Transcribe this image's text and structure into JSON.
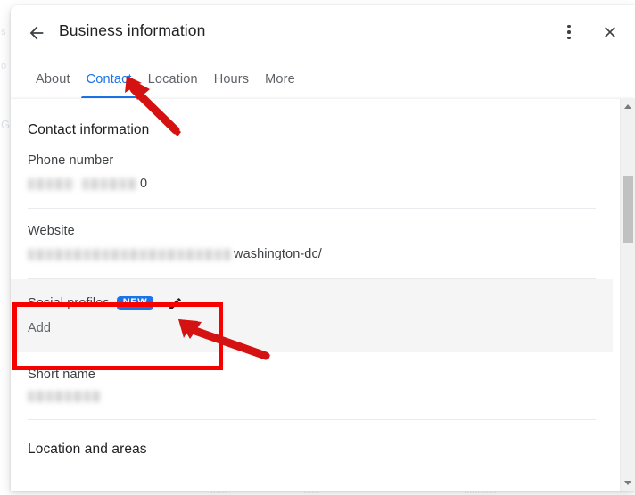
{
  "window": {
    "title": "Business information",
    "back_icon": "arrow-left-icon",
    "menu_icon": "kebab-menu-icon",
    "close_icon": "close-icon"
  },
  "tabs": [
    {
      "label": "About",
      "active": false
    },
    {
      "label": "Contact",
      "active": true
    },
    {
      "label": "Location",
      "active": false
    },
    {
      "label": "Hours",
      "active": false
    },
    {
      "label": "More",
      "active": false
    }
  ],
  "content": {
    "section_title": "Contact information",
    "rows": [
      {
        "label": "Phone number",
        "value_redacted": true,
        "value_suffix": "0",
        "highlight": false
      },
      {
        "label": "Website",
        "value_redacted": true,
        "value_suffix": "washington-dc/",
        "highlight": false
      },
      {
        "label": "Social profiles",
        "badge": "NEW",
        "edit_icon": "pencil-icon",
        "value_text": "Add",
        "highlight": true
      },
      {
        "label": "Short name",
        "value_redacted": true,
        "value_suffix": "",
        "highlight": false
      }
    ],
    "bottom_section_title": "Location and areas"
  },
  "scrollbar": {
    "up_arrow": "scroll-up-arrow-icon",
    "down_arrow": "scroll-down-arrow-icon"
  },
  "annotations": {
    "accent_color": "#f70000",
    "highlight_box_target": "Social profiles",
    "arrow_1_target": "Contact tab",
    "arrow_2_target": "Social profiles edit pencil"
  },
  "backdrop": {
    "ghost_left_1": "s",
    "ghost_left_2": "o",
    "ghost_left_3": "G",
    "ghost_bottom_1": "......",
    "ghost_bottom_2": "......",
    "ghost_bottom_3": "............"
  },
  "colors": {
    "accent_blue": "#1a73e8",
    "badge_blue": "#1b73e8",
    "text_primary": "#202124",
    "text_secondary": "#5f6368",
    "divider": "#e8eaed",
    "row_highlight": "#f5f5f5"
  }
}
